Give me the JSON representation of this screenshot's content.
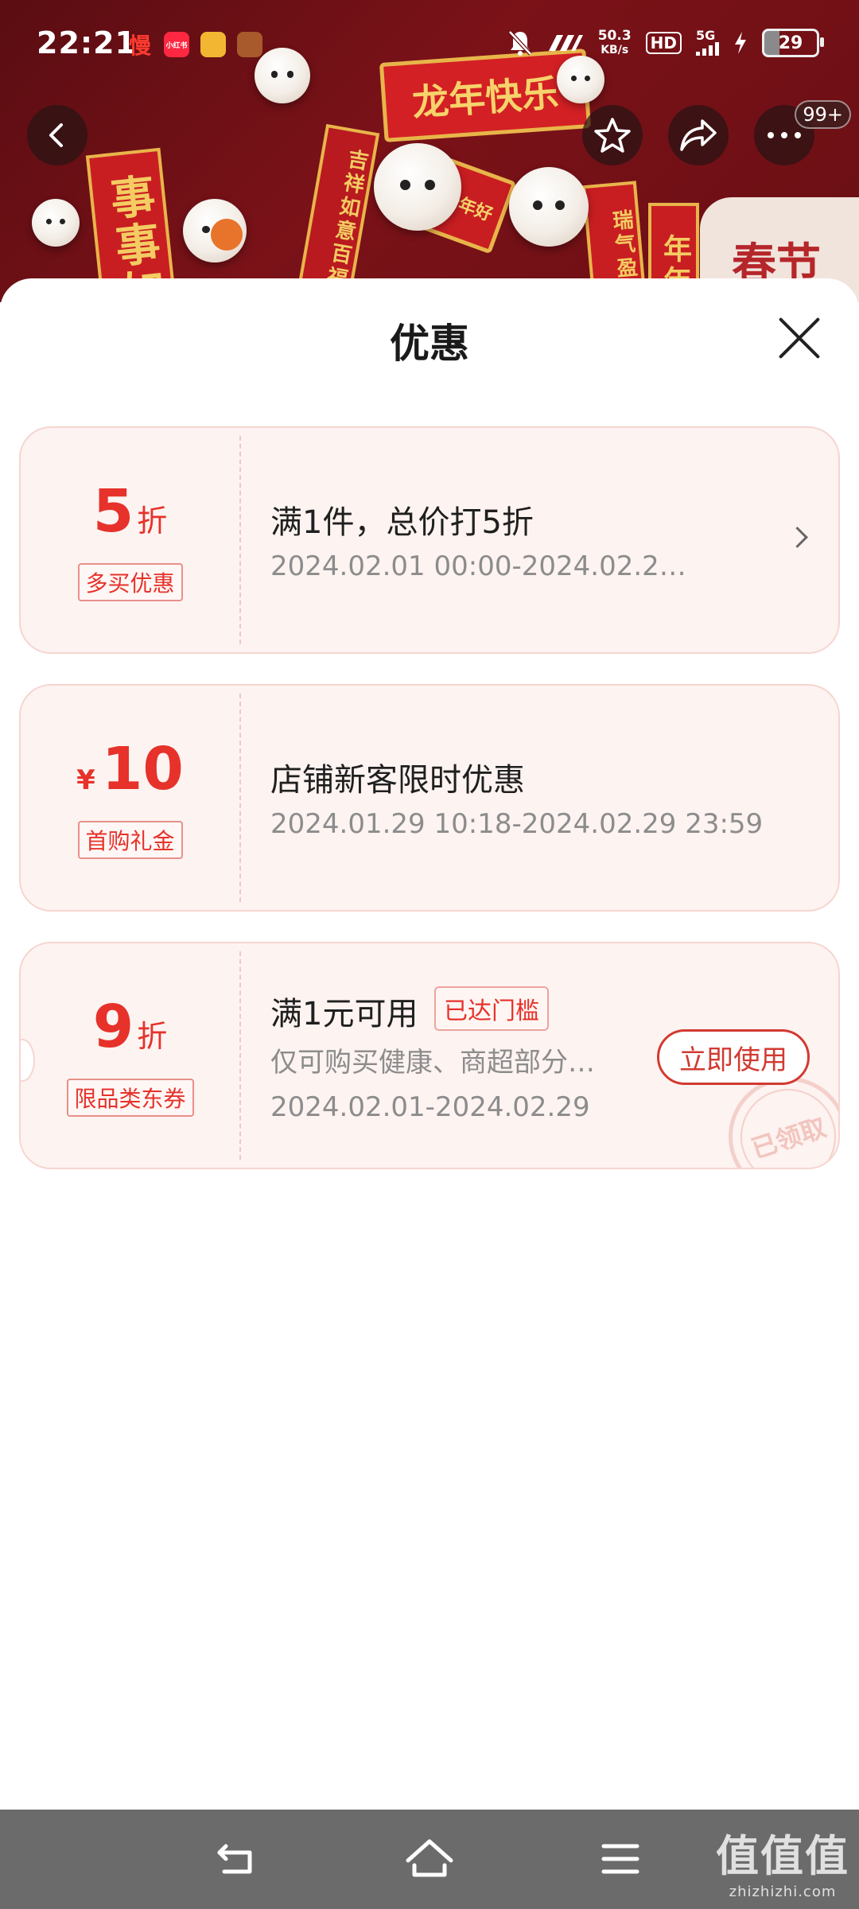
{
  "status_bar": {
    "time": "22:21",
    "app_icons": [
      "慢",
      "小红书",
      "",
      ""
    ],
    "net_speed_value": "50.3",
    "net_speed_unit": "KB/s",
    "hd": "HD",
    "network": "5G",
    "battery": "29"
  },
  "banner": {
    "text_1": "龙年快乐",
    "text_2": "春节",
    "couplet_1": "事事如",
    "couplet_2": "年年",
    "couplet_3": "吉祥如意百福",
    "couplet_4": "新年好",
    "couplet_5": "瑞气盈门"
  },
  "header": {
    "more_badge": "99+"
  },
  "sheet": {
    "title": "优惠"
  },
  "coupons": [
    {
      "value": "5",
      "unit": "折",
      "tag": "多买优惠",
      "title": "满1件，总价打5折",
      "subtitle": "2024.02.01 00:00-2024.02.2…"
    },
    {
      "currency": "¥",
      "value": "10",
      "tag": "首购礼金",
      "title": "店铺新客限时优惠",
      "subtitle": "2024.01.29 10:18-2024.02.29 23:59"
    },
    {
      "value": "9",
      "unit": "折",
      "tag": "限品类东券",
      "title": "满1元可用",
      "badge": "已达门槛",
      "description": "仅可购买健康、商超部分…",
      "subtitle": "2024.02.01-2024.02.29",
      "button": "立即使用",
      "stamp": "已领取"
    }
  ],
  "watermark": {
    "big": "值值值",
    "small": "zhizhizhi.com"
  },
  "colors": {
    "accent": "#e6322a",
    "coupon_bg": "#fdf3f1",
    "nav_bar": "#6b6b6b"
  }
}
